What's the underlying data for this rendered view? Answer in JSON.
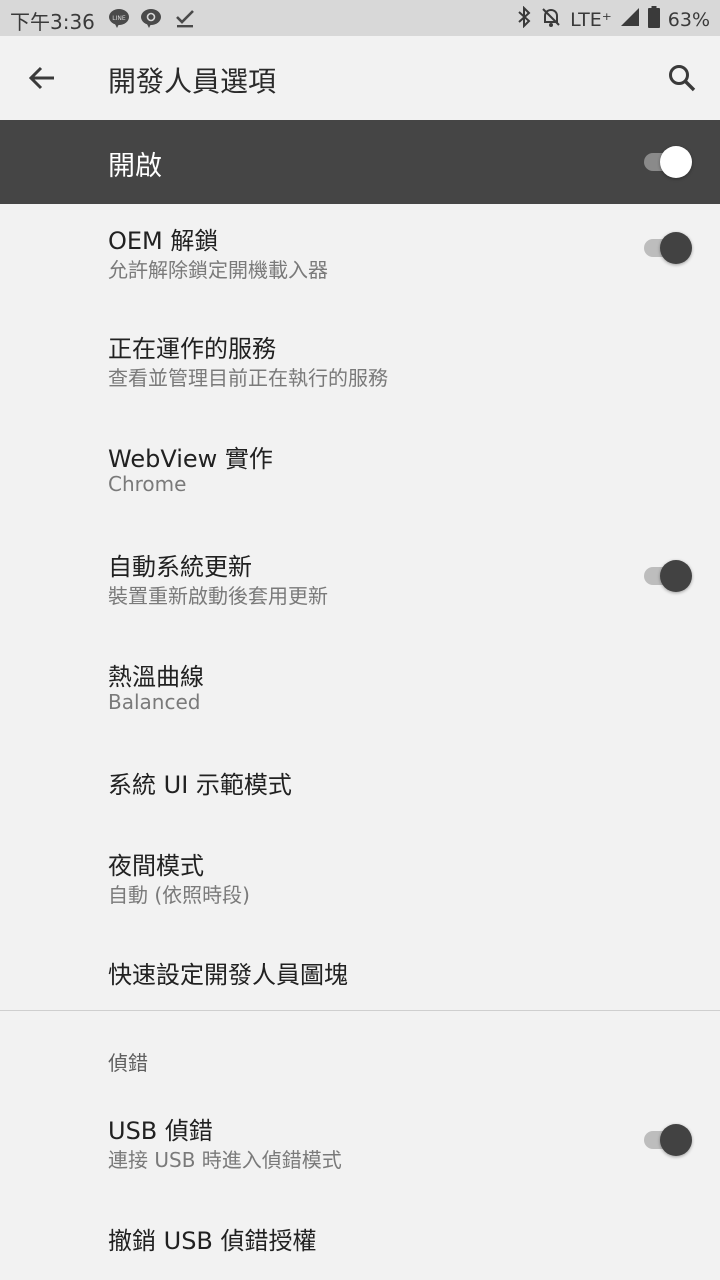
{
  "status_bar": {
    "time": "下午3:36",
    "network": "LTE⁺",
    "battery": "63%",
    "icons": [
      "line-icon",
      "line-check-icon",
      "check-icon",
      "bluetooth-icon",
      "notifications-off-icon",
      "signal-icon",
      "battery-icon"
    ]
  },
  "app_bar": {
    "title": "開發人員選項",
    "back_icon": "arrow-back-icon",
    "search_icon": "search-icon"
  },
  "master": {
    "label": "開啟",
    "enabled": true
  },
  "settings": [
    {
      "title": "OEM 解鎖",
      "summary": "允許解除鎖定開機載入器",
      "toggle": true
    },
    {
      "title": "正在運作的服務",
      "summary": "查看並管理目前正在執行的服務"
    },
    {
      "title": "WebView 實作",
      "summary": "Chrome"
    },
    {
      "title": "自動系統更新",
      "summary": "裝置重新啟動後套用更新",
      "toggle": true
    },
    {
      "title": "熱溫曲線",
      "summary": "Balanced"
    },
    {
      "title": "系統 UI 示範模式"
    },
    {
      "title": "夜間模式",
      "summary": "自動 (依照時段)"
    },
    {
      "title": "快速設定開發人員圖塊"
    }
  ],
  "debug_section": {
    "header": "偵錯",
    "items": [
      {
        "title": "USB 偵錯",
        "summary": "連接 USB 時進入偵錯模式",
        "toggle": true
      },
      {
        "title": "撤銷 USB 偵錯授權"
      }
    ]
  },
  "colors": {
    "master_bg": "#454545",
    "page_bg": "#f2f2f2",
    "statusbar_bg": "#d8d8d8"
  }
}
